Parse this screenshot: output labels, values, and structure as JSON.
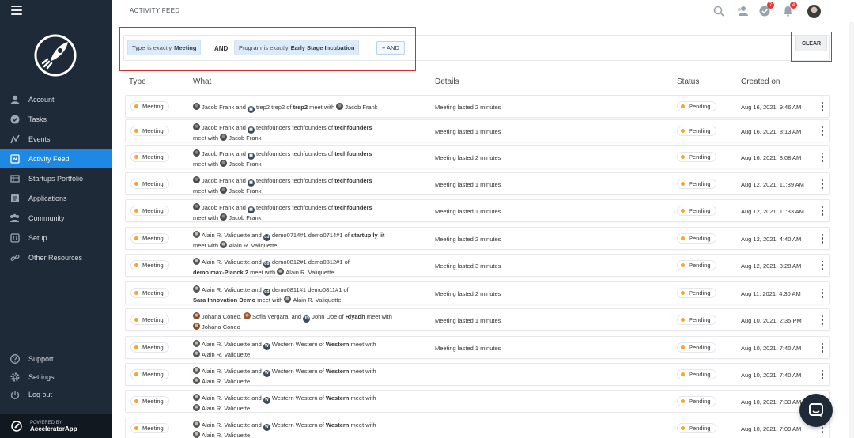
{
  "sidebar": {
    "items": [
      {
        "label": "Account",
        "icon": "user-icon"
      },
      {
        "label": "Tasks",
        "icon": "check-circle-icon"
      },
      {
        "label": "Events",
        "icon": "events-icon"
      },
      {
        "label": "Activity Feed",
        "icon": "activity-icon",
        "active": true
      },
      {
        "label": "Startups Portfolio",
        "icon": "portfolio-icon"
      },
      {
        "label": "Applications",
        "icon": "applications-icon"
      },
      {
        "label": "Community",
        "icon": "community-icon"
      },
      {
        "label": "Setup",
        "icon": "setup-icon"
      },
      {
        "label": "Other Resources",
        "icon": "link-icon"
      }
    ],
    "bottom": [
      {
        "label": "Support",
        "icon": "help-icon"
      },
      {
        "label": "Settings",
        "icon": "gear-icon"
      },
      {
        "label": "Log out",
        "icon": "power-icon"
      }
    ],
    "powered_by": "POWERED BY",
    "brand": "AcceleratorApp"
  },
  "header": {
    "title": "ACTIVITY FEED",
    "tasks_badge": "7",
    "notifications_badge": "4"
  },
  "filters": {
    "chip1": {
      "field": "Type",
      "op": "is exactly",
      "value": "Meeting"
    },
    "and_label": "AND",
    "chip2": {
      "field": "Program",
      "op": "is exactly",
      "value": "Early Stage Incubation"
    },
    "add_and": "+ AND",
    "clear": "CLEAR"
  },
  "table": {
    "headers": {
      "type": "Type",
      "what": "What",
      "details": "Details",
      "status": "Status",
      "created": "Created on"
    }
  },
  "rows": [
    {
      "type": "Meeting",
      "what_html": "<span class='av p1'></span>Jacob Frank and <span class='av org'>▦</span>trep2 trep2 of <b>trep2</b> meet with <span class='av p1'></span>Jacob Frank",
      "details": "Meeting lasted 2 minutes",
      "status": "Pending",
      "created": "Aug 16, 2021, 9:46 AM"
    },
    {
      "type": "Meeting",
      "what_html": "<span class='av p1'></span>Jacob Frank and <span class='av org'>▦</span>techfounders techfounders of <b>techfounders</b><br>meet with <span class='av p1'></span>Jacob Frank",
      "details": "Meeting lasted 1 minutes",
      "status": "Pending",
      "created": "Aug 16, 2021, 8:13 AM"
    },
    {
      "type": "Meeting",
      "what_html": "<span class='av p1'></span>Jacob Frank and <span class='av org'>▦</span>techfounders techfounders of <b>techfounders</b><br>meet with <span class='av p1'></span>Jacob Frank",
      "details": "Meeting lasted 2 minutes",
      "status": "Pending",
      "created": "Aug 16, 2021, 8:08 AM"
    },
    {
      "type": "Meeting",
      "what_html": "<span class='av p1'></span>Jacob Frank and <span class='av org'>▦</span>techfounders techfounders of <b>techfounders</b><br>meet with <span class='av p1'></span>Jacob Frank",
      "details": "Meeting lasted 1 minutes",
      "status": "Pending",
      "created": "Aug 12, 2021, 11:39 AM"
    },
    {
      "type": "Meeting",
      "what_html": "<span class='av p1'></span>Jacob Frank and <span class='av org'>▦</span>techfounders techfounders of <b>techfounders</b><br>meet with <span class='av p1'></span>Jacob Frank",
      "details": "Meeting lasted 1 minutes",
      "status": "Pending",
      "created": "Aug 12, 2021, 11:33 AM"
    },
    {
      "type": "Meeting",
      "what_html": "<span class='av p2'></span>Alain R. Valiquette and <span class='av org'>dd</span>demo0714#1 demo0714#1 of <b>startup ly iit</b><br>meet with <span class='av p2'></span>Alain R. Valiquette",
      "details": "Meeting lasted 2 minutes",
      "status": "Pending",
      "created": "Aug 12, 2021, 4:40 AM"
    },
    {
      "type": "Meeting",
      "what_html": "<span class='av p2'></span>Alain R. Valiquette and <span class='av org'>dd</span>demo0812#1 demo0812#1 of<br><b>demo max-Planck 2</b> meet with <span class='av p2'></span>Alain R. Valiquette",
      "details": "Meeting lasted 3 minutes",
      "status": "Pending",
      "created": "Aug 12, 2021, 3:28 AM"
    },
    {
      "type": "Meeting",
      "what_html": "<span class='av p2'></span>Alain R. Valiquette and <span class='av org'>dd</span>demo0811#1 demo0811#1 of<br><b>Sara Innovation Demo</b> meet with <span class='av p2'></span>Alain R. Valiquette",
      "details": "Meeting lasted 2 minutes",
      "status": "Pending",
      "created": "Aug 11, 2021, 4:30 AM"
    },
    {
      "type": "Meeting",
      "what_html": "<span class='av p3'></span>Johana Coneo, <span class='av p4'></span>Sofia Vergara, and <span class='av org'>JD</span>John Doe of <b>Riyadh</b> meet with<br><span class='av p3'></span>Johana Coneo",
      "details": "Meeting lasted 1 minutes",
      "status": "Pending",
      "created": "Aug 10, 2021, 2:35 PM"
    },
    {
      "type": "Meeting",
      "what_html": "<span class='av p2'></span>Alain R. Valiquette and <span class='av org'>W</span>Western Western of <b>Western</b> meet with<br><span class='av p2'></span>Alain R. Valiquette",
      "details": "Meeting lasted 1 minutes",
      "status": "Pending",
      "created": "Aug 10, 2021, 7:40 AM"
    },
    {
      "type": "Meeting",
      "what_html": "<span class='av p2'></span>Alain R. Valiquette and <span class='av org'>W</span>Western Western of <b>Western</b> meet with<br><span class='av p2'></span>Alain R. Valiquette",
      "details": "",
      "status": "Pending",
      "created": "Aug 10, 2021, 7:40 AM"
    },
    {
      "type": "Meeting",
      "what_html": "<span class='av p2'></span>Alain R. Valiquette and <span class='av org'>W</span>Western Western of <b>Western</b> meet with<br><span class='av p2'></span>Alain R. Valiquette",
      "details": "",
      "status": "Pending",
      "created": "Aug 10, 2021, 7:33 AM"
    },
    {
      "type": "Meeting",
      "what_html": "<span class='av p2'></span>Alain R. Valiquette and <span class='av org'>W</span>Western Western of <b>Western</b> meet with<br><span class='av p2'></span>Alain R. Valiquette",
      "details": "",
      "status": "Pending",
      "created": "Aug 10, 2021, 7:09 AM"
    }
  ],
  "colors": {
    "sidebar": "#1f2a38",
    "accent": "#1e88e5",
    "pending_dot": "#f5a623",
    "highlight": "#d32f2f"
  }
}
